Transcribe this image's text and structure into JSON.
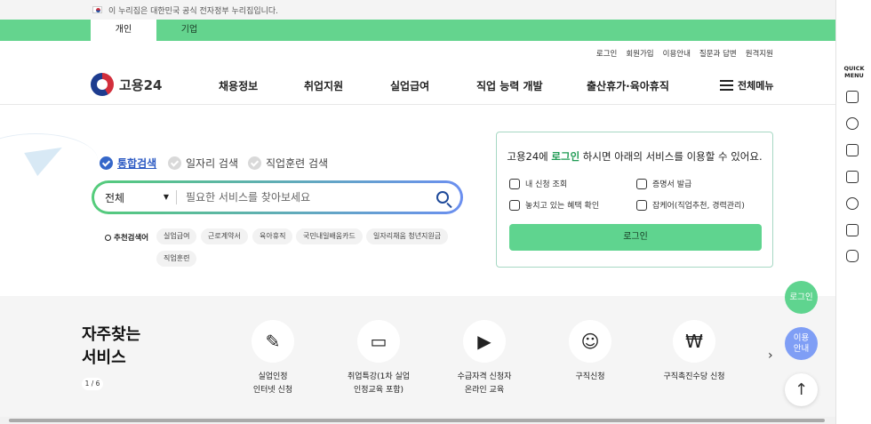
{
  "gov_banner": {
    "text": "이 누리집은 대한민국 공식 전자정부 누리집입니다."
  },
  "user_tabs": [
    {
      "label": "개인"
    },
    {
      "label": "기업"
    }
  ],
  "util_links": [
    "로그인",
    "회원가입",
    "이용안내",
    "질문과 답변",
    "원격지원"
  ],
  "logo": {
    "text": "고용24"
  },
  "gnb": [
    "채용정보",
    "취업지원",
    "실업급여",
    "직업 능력 개발",
    "출산휴가·육아휴직"
  ],
  "all_menu": "전체메뉴",
  "search": {
    "tabs": [
      "통합검색",
      "일자리 검색",
      "직업훈련 검색"
    ],
    "category": "전체",
    "placeholder": "필요한 서비스를 찾아보세요",
    "recommend_label": "추천검색어",
    "keywords": [
      "실업급여",
      "근로계약서",
      "육아휴직",
      "국민내일배움카드",
      "일자리채움 청년지원금",
      "직업훈련"
    ]
  },
  "login_card": {
    "title_pre": "고용24에 ",
    "title_hl": "로그인",
    "title_post": " 하시면 아래의 서비스를 이용할 수 있어요.",
    "items": [
      "내 신청 조회",
      "증명서 발급",
      "놓치고 있는 혜택 확인",
      "잡케어(직업추천, 경력관리)"
    ],
    "button": "로그인"
  },
  "freq": {
    "title_line1": "자주찾는",
    "title_line2": "서비스",
    "pager": "1 / 6",
    "services": [
      {
        "line1": "실업인정",
        "line2": "인터넷 신청"
      },
      {
        "line1": "취업특강(1차 실업",
        "line2": "인정교육 포함)"
      },
      {
        "line1": "수급자격 신청자",
        "line2": "온라인 교육"
      },
      {
        "line1": "구직신청",
        "line2": ""
      },
      {
        "line1": "구직촉진수당 신청",
        "line2": ""
      }
    ]
  },
  "fab": {
    "login": "로그인",
    "guide_line1": "이용",
    "guide_line2": "안내",
    "top": "↑"
  },
  "quick_menu": {
    "title_line1": "QUICK",
    "title_line2": "MENU"
  }
}
